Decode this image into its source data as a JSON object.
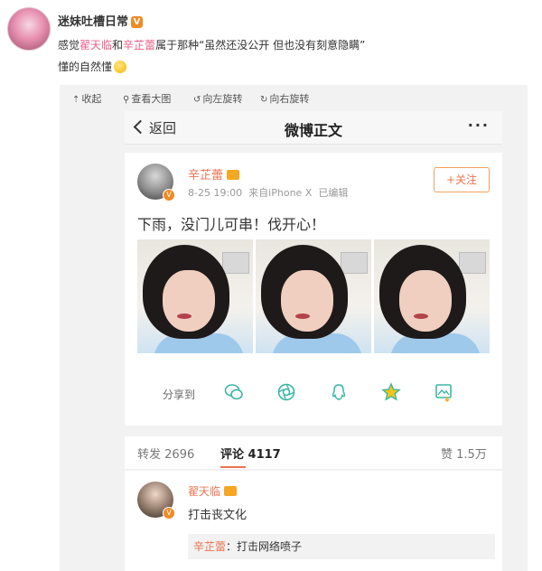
{
  "outer_post": {
    "author": "迷妹吐槽日常",
    "verified_badge": "V",
    "text_part1": "感觉",
    "name1": "翟天临",
    "text_part2": "和",
    "name2": "辛芷蕾",
    "text_part3": "属于那种“虽然还没公开 但也没有刻意隐瞒”",
    "text_line2": "懂的自然懂",
    "emoji": "smile-emoji"
  },
  "image_toolbar": {
    "collapse": "收起",
    "view_large": "查看大图",
    "rotate_left": "向左旋转",
    "rotate_right": "向右旋转"
  },
  "phone": {
    "nav": {
      "back": "返回",
      "title": "微博正文",
      "more": "···"
    },
    "post": {
      "author": "辛芷蕾",
      "time": "8-25 19:00",
      "source": "来自iPhone X",
      "edited": "已编辑",
      "follow": "+关注",
      "text": "下雨，没门儿可串！伐开心！",
      "photo_count": 3,
      "share_label": "分享到",
      "share_icons": [
        "wechat-icon",
        "moments-icon",
        "qq-icon",
        "qzone-icon",
        "save-image-icon"
      ]
    },
    "counts": {
      "repost_label": "转发",
      "repost": "2696",
      "comment_label": "评论",
      "comment": "4117",
      "like_label": "赞",
      "like": "1.5万"
    },
    "comment": {
      "author": "翟天临",
      "text": "打击丧文化",
      "reply_author": "辛芷蕾",
      "reply_text": "打击网络喷子"
    }
  },
  "colors": {
    "accent_orange": "#eb7350",
    "highlight_pink": "#eb5f86",
    "share_icon_teal": "#3ab7a3"
  }
}
